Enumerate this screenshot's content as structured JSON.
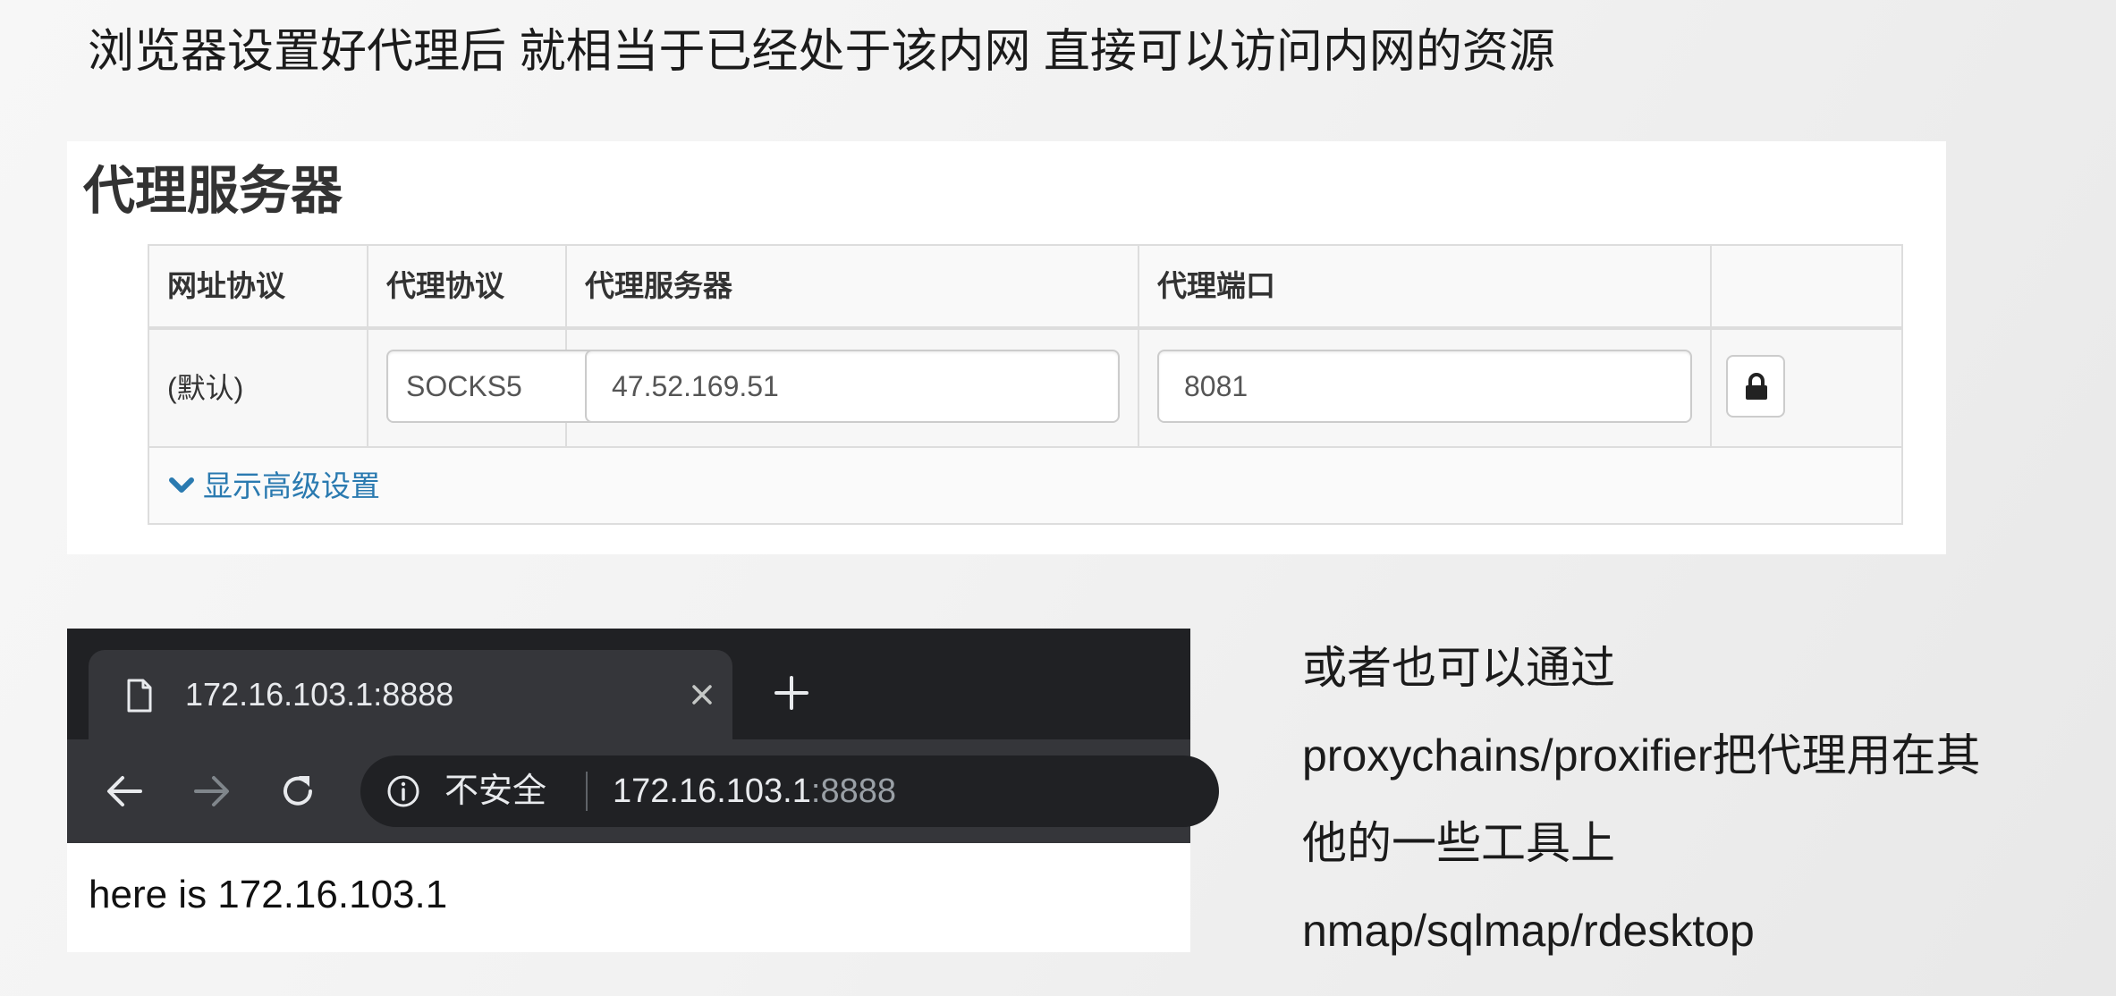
{
  "headline": "浏览器设置好代理后 就相当于已经处于该内网 直接可以访问内网的资源",
  "proxy_panel": {
    "title": "代理服务器",
    "columns": [
      "网址协议",
      "代理协议",
      "代理服务器",
      "代理端口"
    ],
    "row": {
      "url_protocol": "(默认)",
      "proxy_protocol": "SOCKS5",
      "proxy_server": "47.52.169.51",
      "proxy_port": "8081"
    },
    "advanced_link": "显示高级设置",
    "lock_icon": "lock-icon",
    "link_color": "#2a7ab0"
  },
  "browser": {
    "tab_title": "172.16.103.1:8888",
    "omnibox": {
      "security_label": "不安全",
      "url_host": "172.16.103.1",
      "url_port": ":8888"
    },
    "page_text": "here is 172.16.103.1",
    "icons": [
      "page-icon",
      "close-icon",
      "plus-icon",
      "back-arrow-icon",
      "forward-arrow-icon",
      "reload-icon",
      "info-icon"
    ],
    "chrome_colors": {
      "tabstrip": "#202124",
      "toolbar": "#35363a"
    }
  },
  "note": {
    "lines": [
      "或者也可以通过",
      "proxychains/proxifier把代理用在其",
      "他的一些工具上",
      "nmap/sqlmap/rdesktop"
    ]
  }
}
